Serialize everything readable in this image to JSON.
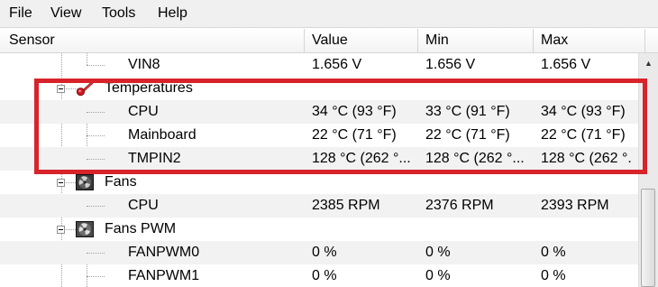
{
  "menu": {
    "file": "File",
    "view": "View",
    "tools": "Tools",
    "help": "Help"
  },
  "columns": {
    "sensor": "Sensor",
    "value": "Value",
    "min": "Min",
    "max": "Max"
  },
  "rows": {
    "vin8": {
      "name": "VIN8",
      "value": "1.656 V",
      "min": "1.656 V",
      "max": "1.656 V"
    },
    "temperatures": {
      "name": "Temperatures",
      "icon": "thermometer-icon"
    },
    "cpu_temp": {
      "name": "CPU",
      "value": "34 °C  (93 °F)",
      "min": "33 °C  (91 °F)",
      "max": "34 °C  (93 °F)"
    },
    "mainboard_temp": {
      "name": "Mainboard",
      "value": "22 °C  (71 °F)",
      "min": "22 °C  (71 °F)",
      "max": "22 °C  (71 °F)"
    },
    "tmpin2": {
      "name": "TMPIN2",
      "value": "128 °C  (262 °...",
      "min": "128 °C  (262 °...",
      "max": "128 °C  (262 °."
    },
    "fans": {
      "name": "Fans",
      "icon": "fan-icon"
    },
    "cpu_fan": {
      "name": "CPU",
      "value": "2385 RPM",
      "min": "2376 RPM",
      "max": "2393 RPM"
    },
    "fans_pwm": {
      "name": "Fans PWM",
      "icon": "fan-icon"
    },
    "fanpwm0": {
      "name": "FANPWM0",
      "value": "0 %",
      "min": "0 %",
      "max": "0 %"
    },
    "fanpwm1": {
      "name": "FANPWM1",
      "value": "0 %",
      "min": "0 %",
      "max": "0 %"
    }
  },
  "colors": {
    "highlight": "#d8232a",
    "alt_row": "#f2f2f2"
  }
}
